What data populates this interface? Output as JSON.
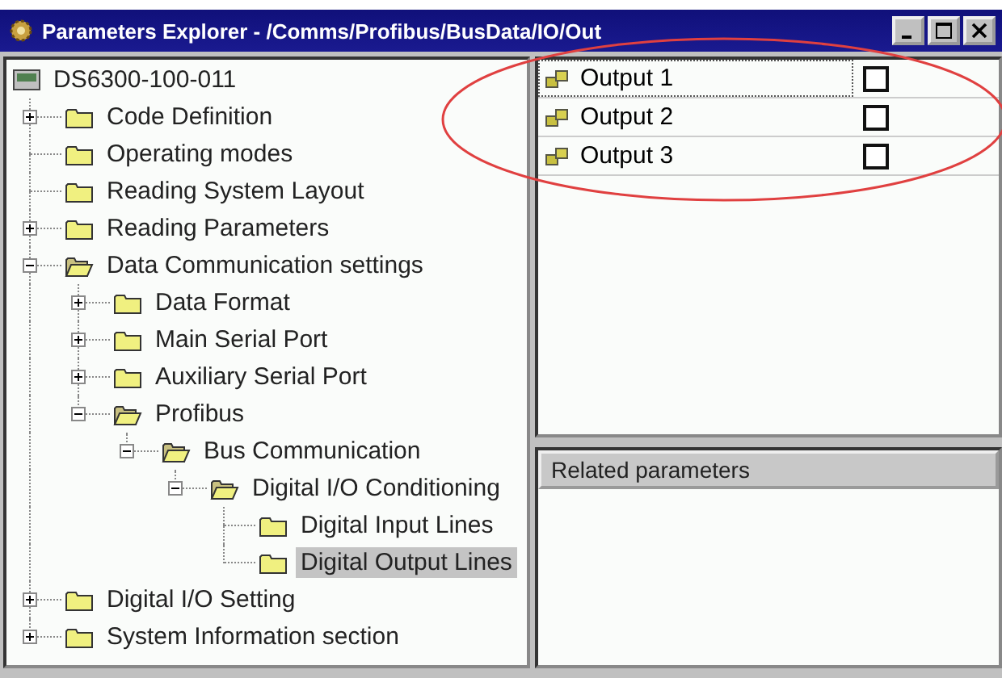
{
  "window": {
    "title": "Parameters Explorer - /Comms/Profibus/BusData/IO/Out"
  },
  "tree": {
    "root": {
      "label": "DS6300-100-011",
      "kind": "device",
      "selected": false,
      "children": [
        {
          "label": "Code Definition",
          "kind": "folder",
          "expanded": false,
          "selected": false
        },
        {
          "label": "Operating modes",
          "kind": "folder",
          "selected": false
        },
        {
          "label": "Reading System Layout",
          "kind": "folder",
          "selected": false
        },
        {
          "label": "Reading Parameters",
          "kind": "folder",
          "expanded": false,
          "selected": false
        },
        {
          "label": "Data Communication settings",
          "kind": "folder",
          "expanded": true,
          "selected": false,
          "children": [
            {
              "label": "Data Format",
              "kind": "folder",
              "expanded": false,
              "selected": false
            },
            {
              "label": "Main Serial Port",
              "kind": "folder",
              "expanded": false,
              "selected": false
            },
            {
              "label": "Auxiliary Serial Port",
              "kind": "folder",
              "expanded": false,
              "selected": false
            },
            {
              "label": "Profibus",
              "kind": "folder",
              "expanded": true,
              "selected": false,
              "children": [
                {
                  "label": "Bus Communication",
                  "kind": "folder",
                  "expanded": true,
                  "selected": false,
                  "children": [
                    {
                      "label": "Digital I/O Conditioning",
                      "kind": "folder",
                      "expanded": true,
                      "selected": false,
                      "children": [
                        {
                          "label": "Digital Input Lines",
                          "kind": "folder",
                          "selected": false
                        },
                        {
                          "label": "Digital Output Lines",
                          "kind": "folder",
                          "selected": true
                        }
                      ]
                    }
                  ]
                }
              ]
            }
          ]
        },
        {
          "label": "Digital I/O Setting",
          "kind": "folder",
          "expanded": false,
          "selected": false
        },
        {
          "label": "System Information section",
          "kind": "folder",
          "expanded": false,
          "selected": false
        }
      ]
    }
  },
  "outputs": [
    {
      "name": "Output 1",
      "focused": true,
      "checked": false
    },
    {
      "name": "Output 2",
      "focused": false,
      "checked": false
    },
    {
      "name": "Output 3",
      "focused": false,
      "checked": false
    }
  ],
  "related": {
    "header": "Related parameters"
  }
}
